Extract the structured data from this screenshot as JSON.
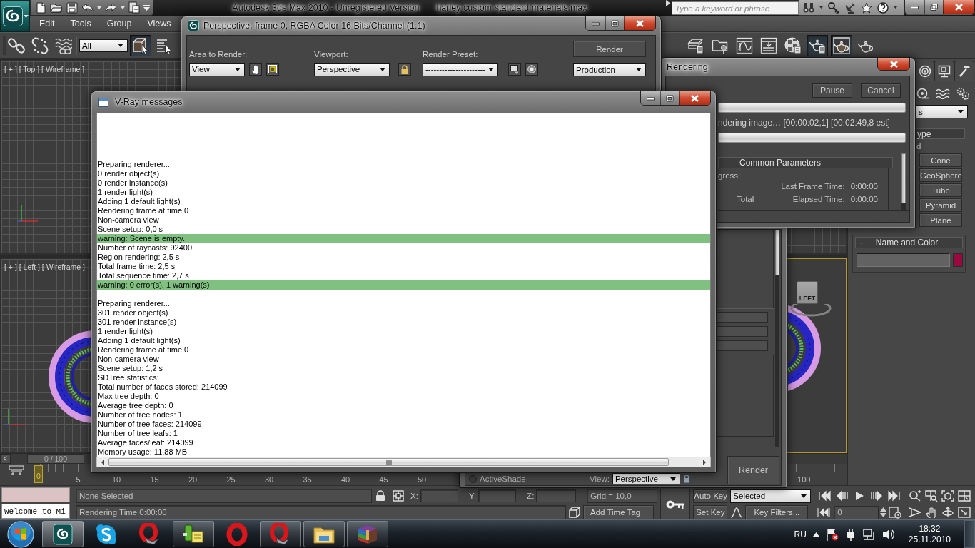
{
  "title_bar": {
    "app_title": "Autodesk 3ds Max 2010 - Unregistered Version",
    "file_name": "harley custom standard materials.max",
    "search": {
      "placeholder": "Type a keyword or phrase"
    }
  },
  "menu": [
    {
      "label": "Edit"
    },
    {
      "label": "Tools"
    },
    {
      "label": "Group"
    },
    {
      "label": "Views"
    }
  ],
  "main_toolbar": {
    "left_tools": [
      {
        "kind": "link",
        "pressed": false
      },
      {
        "kind": "unlink",
        "pressed": false
      },
      {
        "kind": "bind",
        "pressed": false
      }
    ],
    "selection_filter": "All",
    "select_tools": [
      {
        "kind": "select",
        "pressed": true
      },
      {
        "kind": "byname",
        "pressed": false
      }
    ],
    "right_tools": [
      {
        "kind": "layers",
        "pressed": false
      },
      {
        "kind": "namedsets",
        "pressed": false
      },
      {
        "kind": "curves",
        "pressed": false
      },
      {
        "kind": "schematic",
        "pressed": false
      },
      {
        "kind": "material",
        "pressed": false
      },
      {
        "kind": "setup",
        "pressed": true
      },
      {
        "kind": "framewindow",
        "pressed": true
      },
      {
        "kind": "render",
        "pressed": false
      }
    ]
  },
  "viewports": [
    {
      "kind": "top",
      "label": "[ + ] [ Top ] [ Wireframe ]",
      "active": false
    },
    {
      "kind": "front",
      "active": false
    },
    {
      "kind": "left",
      "label": "[ + ] [ Left ] [ Wireframe ]",
      "active": false
    },
    {
      "kind": "perspective",
      "viewcube": "LEFT",
      "active": true
    }
  ],
  "command_panel": {
    "tabs": [
      {
        "kind": "motion",
        "selected": false
      },
      {
        "kind": "display",
        "selected": false
      },
      {
        "kind": "utilities",
        "selected": false
      }
    ],
    "category": "s",
    "rollout_title": "ype",
    "autogrid": "d",
    "object_types": [
      "Cone",
      "GeoSphere",
      "Tube",
      "Pyramid",
      "Plane"
    ],
    "name_and_color": {
      "toggle": "-",
      "title": "Name and Color",
      "color": "#990a3f"
    }
  },
  "time_slider": {
    "back": "<",
    "position": "0 / 100"
  },
  "trackbar": {
    "current_frame": "0",
    "labels": [
      "5",
      "10",
      "15",
      "20",
      "25",
      "30",
      "35",
      "40",
      "45",
      "50"
    ],
    "end_label": "100"
  },
  "status": {
    "listener_output": "Welcome to Mi",
    "selection": "None Selected",
    "coords": [
      {
        "axis": "X:"
      },
      {
        "axis": "Y:"
      },
      {
        "axis": "Z:"
      }
    ],
    "grid": "Grid = 10,0",
    "prompt": "Rendering Time 0:00:00",
    "time_tag": "Add Time Tag"
  },
  "animation": {
    "auto_key": {
      "label": "Auto Key",
      "on": false
    },
    "key_mode": "Selected",
    "set_key": "Set Key",
    "key_filters": "Key Filters...",
    "frame": "0"
  },
  "taskbar": {
    "items": [
      {
        "kind": "modeler",
        "running": true,
        "selected": true
      },
      {
        "kind": "messenger",
        "running": false,
        "selected": false
      },
      {
        "kind": "ringtool",
        "running": false,
        "selected": false
      },
      {
        "kind": "organizer",
        "running": true,
        "selected": false
      },
      {
        "kind": "browser",
        "running": false,
        "selected": false
      },
      {
        "kind": "ringtool",
        "running": true,
        "selected": false
      },
      {
        "kind": "folder",
        "running": true,
        "selected": false
      },
      {
        "kind": "archiver",
        "running": true,
        "selected": false
      }
    ],
    "language": "RU",
    "time": "18:32",
    "date": "25.11.2010"
  },
  "render_frame_window": {
    "title": "Perspective, frame 0, RGBA Color 16 Bits/Channel (1:1)",
    "area_label": "Area to Render:",
    "area": "View",
    "viewport_label": "Viewport:",
    "viewport": "Perspective",
    "preset_label": "Render Preset:",
    "preset": "----------------------",
    "render_button": "Render",
    "render_mode": "Production"
  },
  "render_setup_dialog": {
    "mode": {
      "label": "ActiveShade",
      "selected": false
    },
    "view_label": "View:",
    "view": "Perspective",
    "render_button": "Render"
  },
  "rendering_dialog": {
    "title": "Rendering",
    "buttons": [
      "Pause",
      "Cancel"
    ],
    "total_progress": {
      "level": 0
    },
    "status": "ndering image… [00:00:02,1] [00:02:49,8 est]",
    "image_progress": {
      "level": 0
    },
    "rollout_title": "Common Parameters",
    "group_label": "gress:",
    "last_frame": {
      "label": "Last Frame Time:",
      "value": "0:00:00"
    },
    "total_label": "Total",
    "elapsed": {
      "label": "Elapsed Time:",
      "value": "0:00:00"
    }
  },
  "vray_window": {
    "title": "V-Ray messages",
    "lines": [
      {
        "kind": "info",
        "text": "Preparing renderer..."
      },
      {
        "kind": "info",
        "text": "0 render object(s)"
      },
      {
        "kind": "info",
        "text": "0 render instance(s)"
      },
      {
        "kind": "info",
        "text": "1 render light(s)"
      },
      {
        "kind": "info",
        "text": "Adding 1 default light(s)"
      },
      {
        "kind": "info",
        "text": "Rendering frame at time 0"
      },
      {
        "kind": "info",
        "text": "Non-camera view"
      },
      {
        "kind": "info",
        "text": "Scene setup: 0,0 s"
      },
      {
        "kind": "warning",
        "text": "warning: Scene is empty."
      },
      {
        "kind": "info",
        "text": "Number of raycasts: 92400"
      },
      {
        "kind": "info",
        "text": "Region rendering: 2,5 s"
      },
      {
        "kind": "info",
        "text": "Total frame time: 2,5 s"
      },
      {
        "kind": "info",
        "text": "Total sequence time: 2,7 s"
      },
      {
        "kind": "warning",
        "text": "warning: 0 error(s), 1 warning(s)"
      },
      {
        "kind": "info",
        "text": "=============================="
      },
      {
        "kind": "info",
        "text": "Preparing renderer..."
      },
      {
        "kind": "info",
        "text": "301 render object(s)"
      },
      {
        "kind": "info",
        "text": "301 render instance(s)"
      },
      {
        "kind": "info",
        "text": "1 render light(s)"
      },
      {
        "kind": "info",
        "text": "Adding 1 default light(s)"
      },
      {
        "kind": "info",
        "text": "Rendering frame at time 0"
      },
      {
        "kind": "info",
        "text": "Non-camera view"
      },
      {
        "kind": "info",
        "text": "Scene setup: 1,2 s"
      },
      {
        "kind": "info",
        "text": "SDTree statistics:"
      },
      {
        "kind": "info",
        "text": "Total number of faces stored: 214099"
      },
      {
        "kind": "info",
        "text": "Max tree depth: 0"
      },
      {
        "kind": "info",
        "text": "Average tree depth: 0"
      },
      {
        "kind": "info",
        "text": "Number of tree nodes: 1"
      },
      {
        "kind": "info",
        "text": "Number of tree faces: 214099"
      },
      {
        "kind": "info",
        "text": "Number of tree leafs: 1"
      },
      {
        "kind": "info",
        "text": "Average faces/leaf: 214099"
      },
      {
        "kind": "info",
        "text": "Memory usage: 11,88 MB"
      }
    ]
  }
}
